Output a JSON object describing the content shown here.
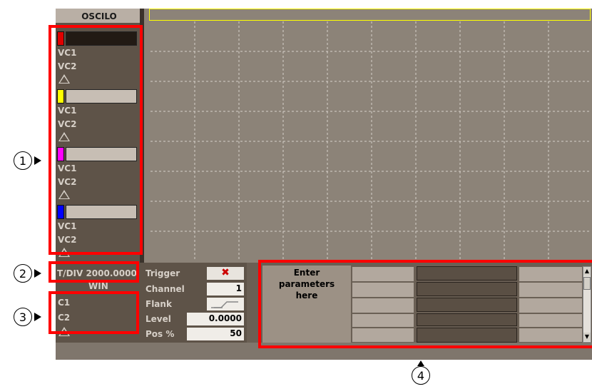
{
  "left_panel": {
    "title": "OSCILO",
    "channels": [
      {
        "color": "#e00000",
        "bar_style": "dark",
        "items": [
          "VC1",
          "VC2"
        ]
      },
      {
        "color": "#ffff00",
        "bar_style": "light",
        "items": [
          "VC1",
          "VC2"
        ]
      },
      {
        "color": "#ff00ff",
        "bar_style": "light",
        "items": [
          "VC1",
          "VC2"
        ]
      },
      {
        "color": "#0000ff",
        "bar_style": "light",
        "items": [
          "VC1",
          "VC2"
        ]
      }
    ],
    "tdiv_label": "T/DIV 2000.0000",
    "win_label": "WIN",
    "win_items": [
      "C1",
      "C2"
    ]
  },
  "trigger": {
    "labels": {
      "trigger": "Trigger",
      "channel": "Channel",
      "flank": "Flank",
      "level": "Level",
      "pos": "Pos %"
    },
    "values": {
      "trigger": "✖",
      "channel": "1",
      "level": "0.0000",
      "pos": "50"
    }
  },
  "params": {
    "title": "Enter parameters here"
  },
  "callouts": [
    "1",
    "2",
    "3",
    "4"
  ],
  "colors": {
    "highlight": "#ff0000",
    "panel": "#5e5348",
    "scope": "#8c8378",
    "trace_box": "#ffff00"
  }
}
